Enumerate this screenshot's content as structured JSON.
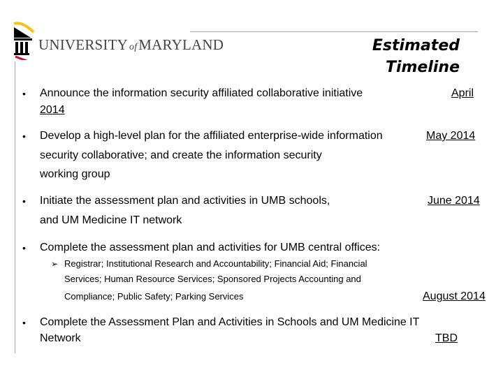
{
  "logo": {
    "word1": "UNIVERSITY",
    "of": "of",
    "word2": "MARYLAND",
    "colors": {
      "gold": "#f2c418",
      "black": "#000000",
      "red": "#c8102e"
    }
  },
  "heading": {
    "line1": "Estimated",
    "line2": "Timeline"
  },
  "accent_color": "#d98a92",
  "items": [
    {
      "bullet": "•",
      "lines": [
        "Announce the information security affiliated collaborative initiative"
      ],
      "date_parts": [
        "April",
        "2014"
      ]
    },
    {
      "bullet": "•",
      "lines": [
        "Develop a high-level plan for the affiliated enterprise-wide information",
        "security collaborative;  and create the information security",
        "working group"
      ],
      "date": "May 2014"
    },
    {
      "bullet": "•",
      "lines": [
        "Initiate the assessment plan and activities in UMB schools,",
        "and UM Medicine IT network"
      ],
      "date": "June 2014"
    },
    {
      "bullet": "•",
      "lines": [
        "Complete the assessment plan and activities for UMB central offices:"
      ],
      "sub_bullet": "➢",
      "sub_lines": [
        "Registrar; Institutional Research and Accountability; Financial Aid; Financial",
        "Services; Human Resource Services; Sponsored Projects Accounting and",
        "Compliance; Public Safety; Parking Services"
      ],
      "date": "August 2014"
    },
    {
      "bullet": "•",
      "lines": [
        "Complete the Assessment Plan and Activities in Schools and UM Medicine IT",
        "Network"
      ],
      "date": "TBD"
    }
  ]
}
